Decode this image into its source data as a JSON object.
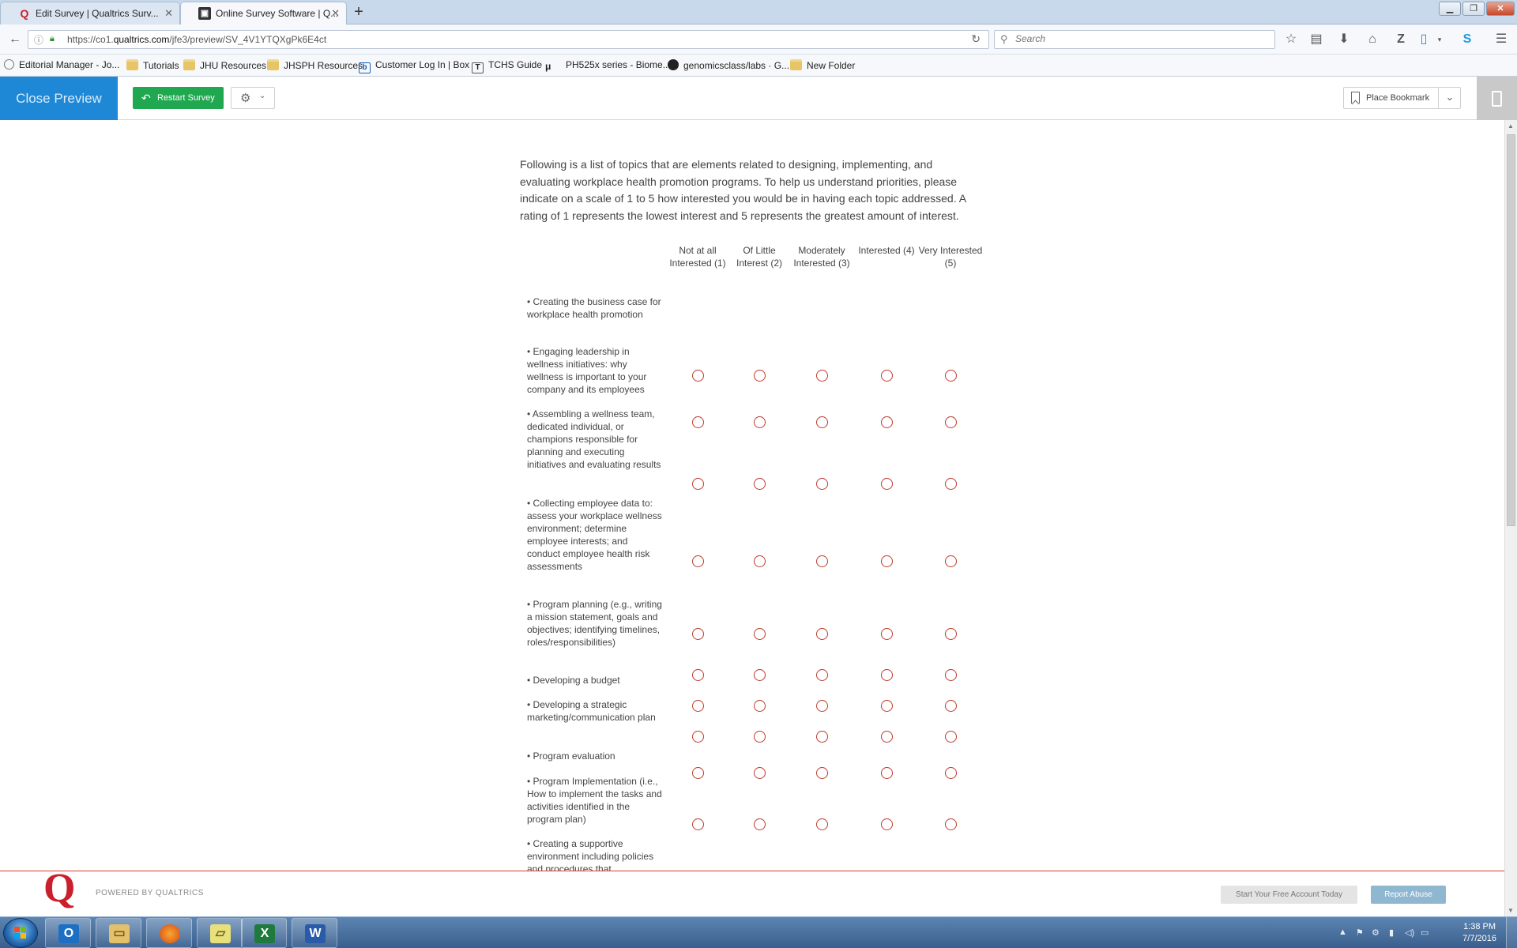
{
  "browser": {
    "tabs": [
      {
        "title": "Edit Survey | Qualtrics Surv...",
        "active": false
      },
      {
        "title": "Online Survey Software | Q...",
        "active": true
      }
    ],
    "url_prefix": "https://co1.",
    "url_domain": "qualtrics.com",
    "url_path": "/jfe3/preview/SV_4V1YTQXgPk6E4ct",
    "search_placeholder": "Search",
    "bookmarks": [
      {
        "label": "Editorial Manager - Jo...",
        "icon": "editorial-manager-icon"
      },
      {
        "label": "Tutorials",
        "icon": "folder-icon"
      },
      {
        "label": "JHU Resources",
        "icon": "folder-icon"
      },
      {
        "label": "JHSPH Resources",
        "icon": "folder-icon"
      },
      {
        "label": "Customer Log In | Box",
        "icon": "box-icon"
      },
      {
        "label": "TCHS Guide",
        "icon": "tchs-icon"
      },
      {
        "label": "PH525x series - Biome...",
        "icon": "mu-icon"
      },
      {
        "label": "genomicsclass/labs · G...",
        "icon": "github-icon"
      },
      {
        "label": "New Folder",
        "icon": "folder-icon"
      }
    ]
  },
  "preview_header": {
    "close_preview": "Close Preview",
    "restart_survey": "Restart Survey",
    "place_bookmark": "Place Bookmark"
  },
  "survey": {
    "intro": "Following is a list of topics that are elements related to designing, implementing, and evaluating workplace health promotion programs. To help us understand priorities, please indicate on a scale of 1 to 5 how interested you would be in having each topic addressed.  A rating of 1 represents the lowest interest and 5 represents the greatest amount of interest.",
    "columns": [
      "Not at all Interested (1)",
      "Of Little Interest (2)",
      "Moderately Interested (3)",
      "Interested (4)",
      "Very Interested (5)"
    ],
    "rows": [
      "• Creating the business case for workplace health promotion",
      "• Engaging leadership in wellness initiatives: why wellness is important to your company and its employees",
      "• Assembling a wellness team, dedicated individual, or champions responsible for planning and executing initiatives and evaluating results",
      "• Collecting employee data to: assess your workplace wellness environment; determine employee interests; and conduct employee health risk assessments",
      "• Program planning (e.g., writing a mission statement, goals and objectives; identifying timelines, roles/responsibilities)",
      "• Developing a budget",
      "• Developing a strategic marketing/communication plan",
      "• Program evaluation",
      "• Program Implementation (i.e., How to implement the tasks and activities identified in the program plan)",
      "• Creating a supportive environment including policies and procedures that"
    ]
  },
  "footer": {
    "powered_by": "POWERED BY QUALTRICS",
    "free_account": "Start Your Free Account Today",
    "report_abuse": "Report Abuse"
  },
  "taskbar": {
    "apps": [
      "Outlook",
      "Windows Explorer",
      "Firefox",
      "Sticky Notes",
      "Excel",
      "Word"
    ],
    "time": "1:38 PM",
    "date": "7/7/2016"
  },
  "colors": {
    "close_preview_bg": "#1e88d6",
    "restart_bg": "#1fa84f",
    "radio_border": "#c0392b",
    "footer_rule": "#e23b2e",
    "report_abuse_bg": "#8fb8d0"
  }
}
